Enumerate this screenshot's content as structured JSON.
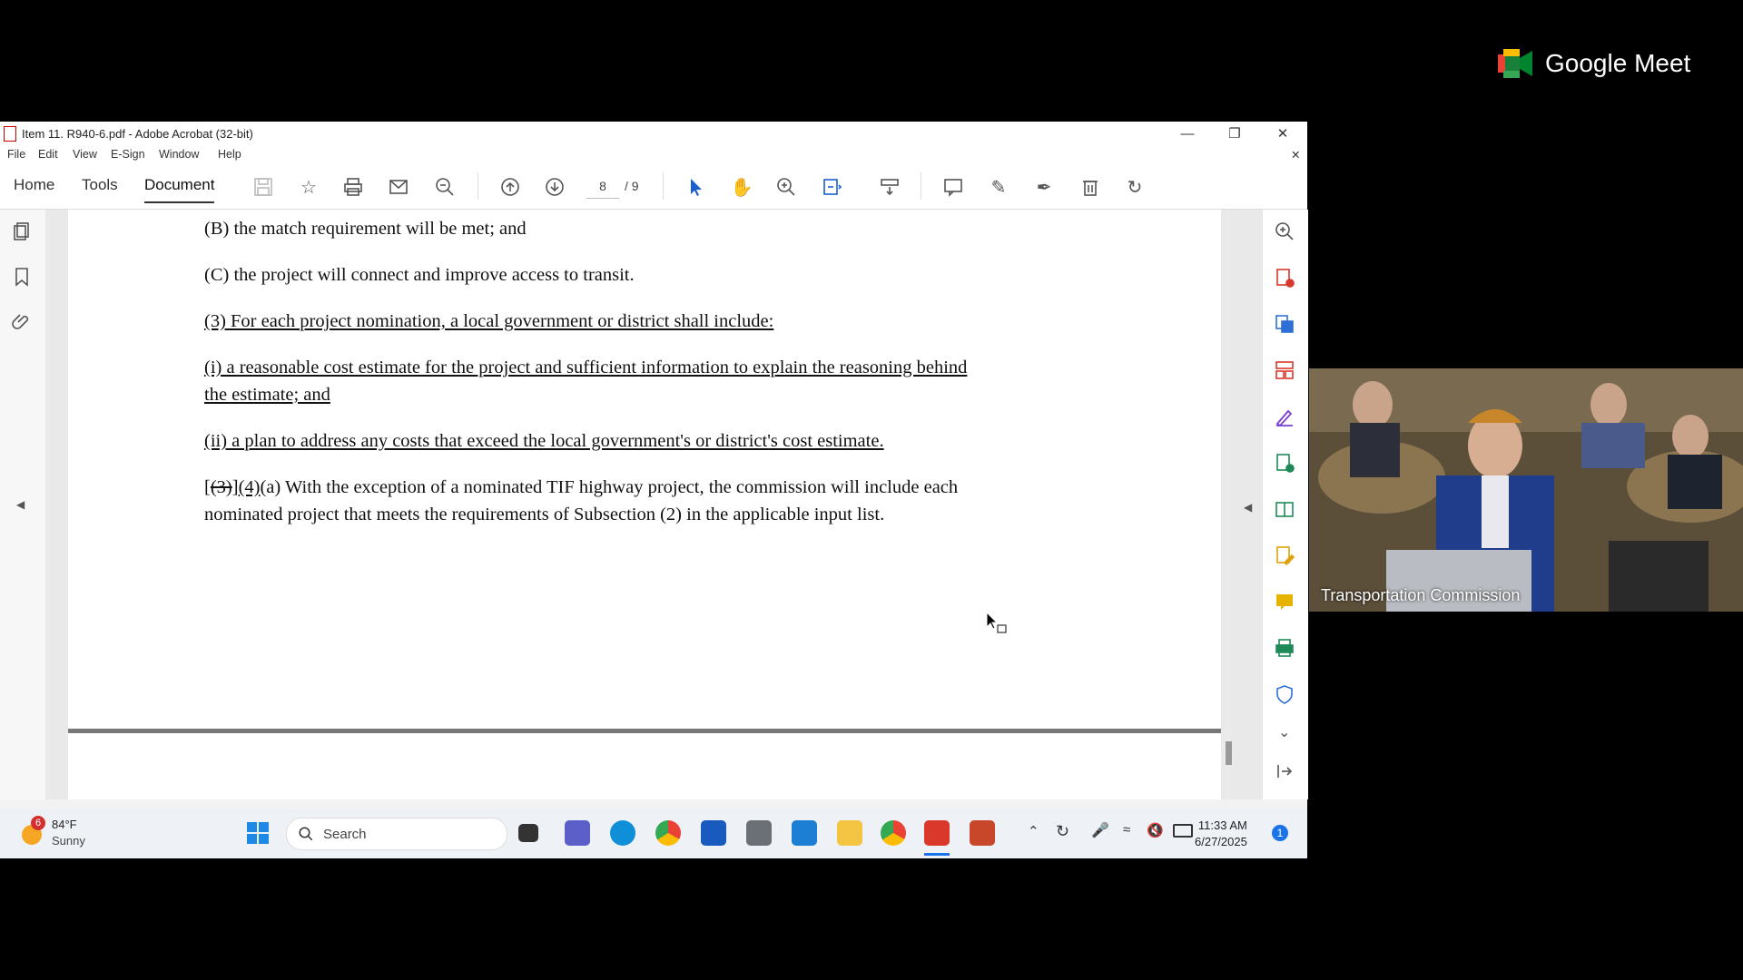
{
  "meet": {
    "brand": "Google Meet",
    "participant_label": "Transportation Commission"
  },
  "window": {
    "title": "Item 11. R940-6.pdf - Adobe Acrobat (32-bit)"
  },
  "menu": [
    "File",
    "Edit",
    "View",
    "E-Sign",
    "Window",
    "Help"
  ],
  "tabs": [
    "Home",
    "Tools",
    "Document"
  ],
  "page_nav": {
    "current": "8",
    "total": "/ 9"
  },
  "document": {
    "p1": "(B)  the match requirement will be met; and",
    "p2": "(C)  the project will connect and improve access to transit.",
    "p3": "(3) For each project nomination, a local government or district shall include:",
    "p4a": "(i)  a reasonable cost estimate for the project and sufficient information to explain the reasoning behind",
    "p4b": "the estimate; and",
    "p5": "(ii)  a plan to address any costs that exceed the local government's or district's cost estimate.",
    "p6_open": "[",
    "p6_strike": "(3)",
    "p6_close": "]",
    "p6_new": "(4)",
    "p6_rest": "(a)  With the exception of a nominated TIF highway project, the commission will include each",
    "p6b": "nominated project that meets the requirements of Subsection (2) in the applicable input list."
  },
  "taskbar": {
    "weather_temp": "84°F",
    "weather_cond": "Sunny",
    "weather_badge": "6",
    "search_placeholder": "Search",
    "time": "11:33 AM",
    "date": "6/27/2025",
    "notif_count": "1"
  }
}
